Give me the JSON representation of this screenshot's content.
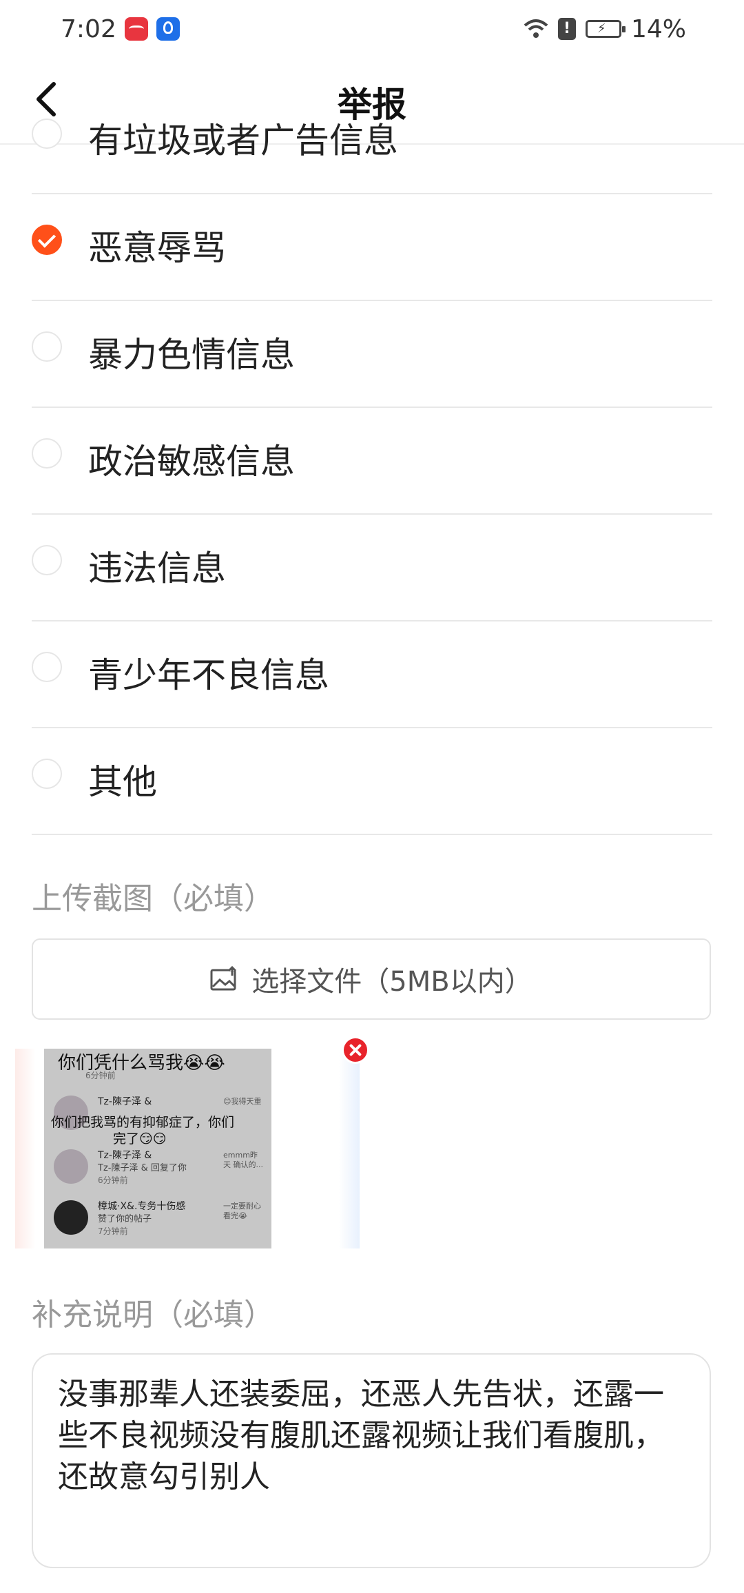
{
  "status_bar": {
    "time": "7:02",
    "battery": "14%",
    "alert": "!"
  },
  "header": {
    "title": "举报"
  },
  "options": [
    {
      "label": "有垃圾或者广告信息",
      "checked": false
    },
    {
      "label": "恶意辱骂",
      "checked": true
    },
    {
      "label": "暴力色情信息",
      "checked": false
    },
    {
      "label": "政治敏感信息",
      "checked": false
    },
    {
      "label": "违法信息",
      "checked": false
    },
    {
      "label": "青少年不良信息",
      "checked": false
    },
    {
      "label": "其他",
      "checked": false
    }
  ],
  "upload": {
    "section_label": "上传截图（必填）",
    "button_label": "选择文件（5MB以内）"
  },
  "screenshot": {
    "headline": "你们凭什么骂我😭😭",
    "overlay_line1": "你们把我骂的有抑郁症了，你们",
    "overlay_line2": "完了😏😏",
    "time0": "6分钟前",
    "rows": [
      {
        "name": "Tz-陳子泽 &",
        "sub": "",
        "time": "6分钟前",
        "right": "😊我得天重"
      },
      {
        "name": "Tz-陳子泽 &",
        "sub": "Tz-陳子泽 & 回复了你",
        "time": "6分钟前",
        "right": "emmm昨天 确认的..."
      },
      {
        "name": "樟城·X&.专务十伤感",
        "sub": "赞了你的帖子",
        "time": "7分钟前",
        "right": "一定要耐心 看完😭"
      }
    ]
  },
  "description": {
    "section_label": "补充说明（必填）",
    "text": "没事那辈人还装委屈，还恶人先告状，还露一些不良视频没有腹肌还露视频让我们看腹肌，还故意勾引别人"
  },
  "colors": {
    "accent": "#ff5019",
    "delete": "#e8232b"
  }
}
